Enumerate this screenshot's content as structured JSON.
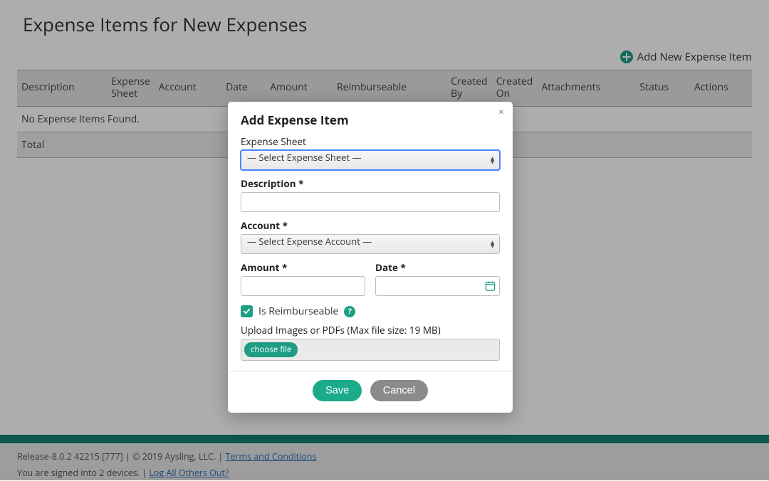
{
  "page": {
    "title": "Expense Items for New Expenses",
    "add_link": "Add New Expense Item"
  },
  "table": {
    "columns": [
      "Description",
      "Expense Sheet",
      "Account",
      "Date",
      "Amount",
      "Reimburseable",
      "Created By",
      "Created On",
      "Attachments",
      "Status",
      "Actions"
    ],
    "empty_msg": "No Expense Items Found.",
    "total_label": "Total"
  },
  "modal": {
    "title": "Add Expense Item",
    "close": "×",
    "fields": {
      "expense_sheet_label": "Expense Sheet",
      "expense_sheet_selected": "— Select Expense Sheet —",
      "description_label": "Description",
      "account_label": "Account",
      "account_selected": "— Select Expense Account —",
      "amount_label": "Amount",
      "date_label": "Date",
      "reimburseable_label": "Is Reimburseable",
      "reimburseable_checked": true,
      "upload_label": "Upload Images or PDFs (Max file size: 19 MB)",
      "choose_file": "choose file"
    },
    "buttons": {
      "save": "Save",
      "cancel": "Cancel"
    }
  },
  "footer": {
    "release": "Release-8.0.2 42215 [777]",
    "sep1": " | ",
    "copyright": "© 2019 Aysling, LLC.",
    "sep2": " | ",
    "terms": "Terms and Conditions",
    "signed_in": "You are signed into 2 devices.",
    "sep3": " | ",
    "logout_others": "Log All Others Out?"
  }
}
